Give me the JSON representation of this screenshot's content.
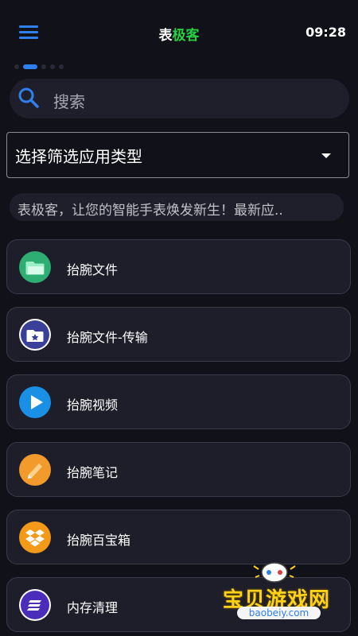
{
  "header": {
    "title_part1": "表",
    "title_part2": "极客",
    "time": "09:28"
  },
  "carousel": {
    "dot_count": 5,
    "active_index": 0
  },
  "search": {
    "placeholder": "搜索"
  },
  "filter": {
    "label": "选择筛选应用类型"
  },
  "notice": {
    "text": "表极客，让您的智能手表焕发新生！最新应.."
  },
  "apps": [
    {
      "name": "抬腕文件",
      "icon": "folder-icon",
      "color": "#2fae74"
    },
    {
      "name": "抬腕文件-传输",
      "icon": "folder-star-icon",
      "color": "#3a3f9a"
    },
    {
      "name": "抬腕视频",
      "icon": "play-icon",
      "color": "#1a8fe6"
    },
    {
      "name": "抬腕笔记",
      "icon": "pencil-icon",
      "color": "#f39a2c"
    },
    {
      "name": "抬腕百宝箱",
      "icon": "dropbox-icon",
      "color": "#f39a18"
    },
    {
      "name": "内存清理",
      "icon": "lines-icon",
      "color": "#4b2dbb"
    }
  ],
  "watermark": {
    "text": "宝贝游戏网",
    "url": "baobeiy.com"
  },
  "colors": {
    "accent": "#2f80ed",
    "title_green": "#26d042",
    "background": "#111119"
  }
}
